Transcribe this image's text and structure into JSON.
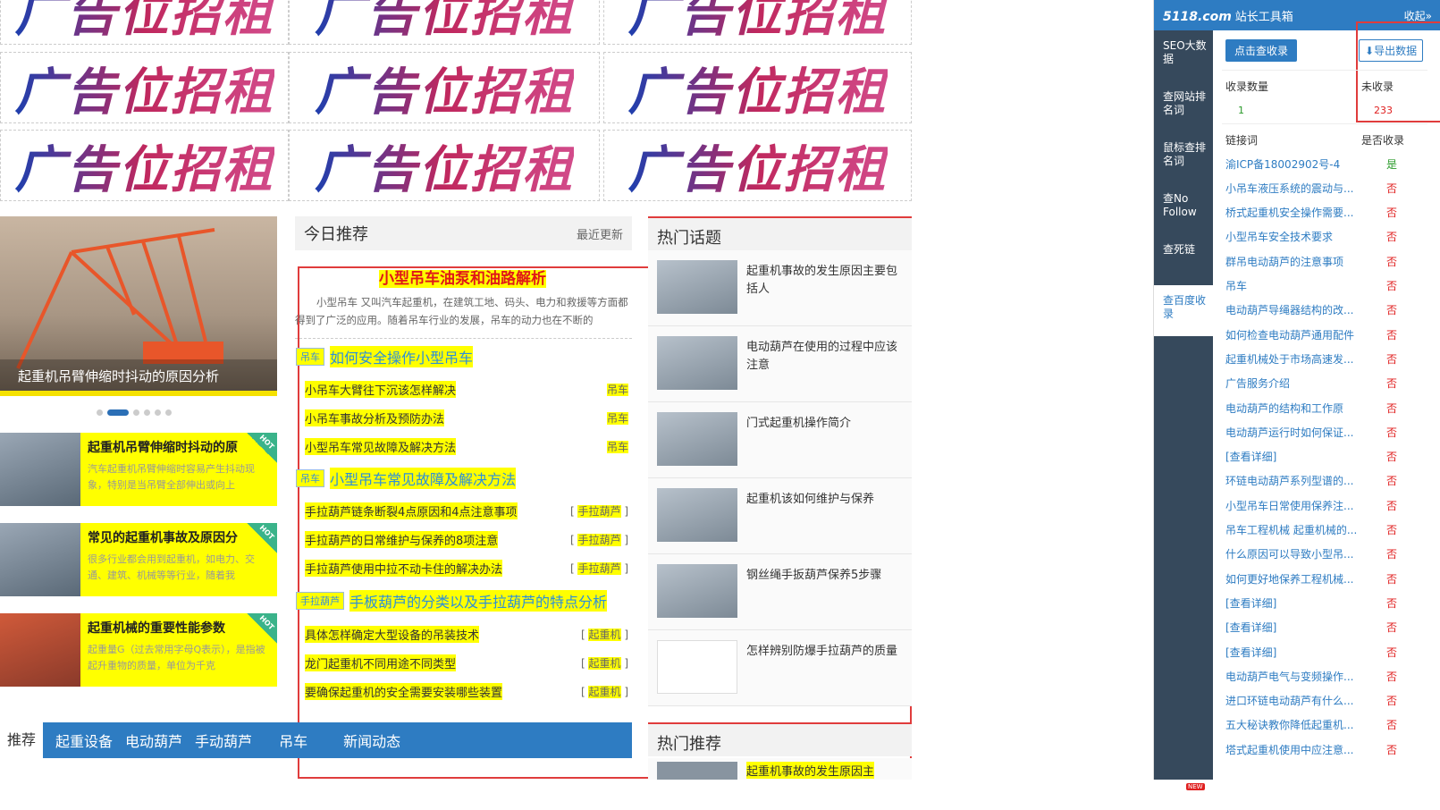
{
  "ads": {
    "label": "广告位招租"
  },
  "slider": {
    "caption": "起重机吊臂伸缩时抖动的原因分析"
  },
  "cards": [
    {
      "title": "起重机吊臂伸缩时抖动的原",
      "desc": "汽车起重机吊臂伸缩时容易产生抖动现象，特别是当吊臂全部伸出或向上",
      "badge": "HOT"
    },
    {
      "title": "常见的起重机事故及原因分",
      "desc": "很多行业都会用到起重机，如电力、交通、建筑、机械等等行业，随着我",
      "badge": "HOT"
    },
    {
      "title": "起重机械的重要性能参数",
      "desc": "起重量G（过去常用字母Q表示），是指被起升重物的质量，单位为千克",
      "badge": "HOT"
    }
  ],
  "recommend": {
    "title": "今日推荐",
    "more": "最近更新",
    "feature_title": "小型吊车油泵和油路解析",
    "feature_desc": "小型吊车 又叫汽车起重机，在建筑工地、码头、电力和救援等方面都得到了广泛的应用。随着吊车行业的发展，吊车的动力也在不断的",
    "sections": [
      {
        "tag": "吊车",
        "title": "如何安全操作小型吊车",
        "rows": [
          {
            "text": "小吊车大臂往下沉该怎样解决",
            "cat": "吊车"
          },
          {
            "text": "小吊车事故分析及预防办法",
            "cat": "吊车"
          },
          {
            "text": "小型吊车常见故障及解决方法",
            "cat": "吊车"
          }
        ]
      },
      {
        "tag": "吊车",
        "title": "小型吊车常见故障及解决方法",
        "rows": [
          {
            "text": "手拉葫芦链条断裂4点原因和4点注意事项",
            "cat": "手拉葫芦"
          },
          {
            "text": "手拉葫芦的日常维护与保养的8项注意",
            "cat": "手拉葫芦"
          },
          {
            "text": "手拉葫芦使用中拉不动卡住的解决办法",
            "cat": "手拉葫芦"
          }
        ]
      },
      {
        "tag": "手拉葫芦",
        "title": "手板葫芦的分类以及手拉葫芦的特点分析",
        "rows": [
          {
            "text": "具体怎样确定大型设备的吊装技术",
            "cat": "起重机"
          },
          {
            "text": "龙门起重机不同用途不同类型",
            "cat": "起重机"
          },
          {
            "text": "要确保起重机的安全需要安装哪些装置",
            "cat": "起重机"
          }
        ]
      }
    ]
  },
  "hot_topics": {
    "title": "热门话题",
    "items": [
      "起重机事故的发生原因主要包括人",
      "电动葫芦在使用的过程中应该注意",
      "门式起重机操作简介",
      "起重机该如何维护与保养",
      "钢丝绳手扳葫芦保养5步骤",
      "怎样辨别防爆手拉葫芦的质量"
    ]
  },
  "hot_recommend": {
    "title": "热门推荐",
    "first": "起重机事故的发生原因主"
  },
  "nav": {
    "items": [
      "推荐",
      "起重设备",
      "电动葫芦",
      "手动葫芦",
      "吊车",
      "新闻动态"
    ]
  },
  "panel": {
    "logo": "5118.com",
    "logo_sub": "站长工具箱",
    "collapse": "收起»",
    "side": [
      "SEO大数据",
      "查网站排名词",
      "鼠标查排名词",
      "查No Follow",
      "查死链",
      "查百度收录"
    ],
    "check_btn": "点击查收录",
    "export_btn": "导出数据",
    "indexed_label": "收录数量",
    "unindexed_label": "未收录",
    "indexed_value": "1",
    "unindexed_value": "233",
    "col_link": "链接词",
    "col_status": "是否收录",
    "rows": [
      {
        "k": "渝ICP备18002902号-4",
        "v": "是"
      },
      {
        "k": "小吊车液压系统的震动与...",
        "v": "否"
      },
      {
        "k": "桥式起重机安全操作需要...",
        "v": "否"
      },
      {
        "k": "小型吊车安全技术要求",
        "v": "否"
      },
      {
        "k": "群吊电动葫芦的注意事项",
        "v": "否"
      },
      {
        "k": "吊车",
        "v": "否"
      },
      {
        "k": "电动葫芦导绳器结构的改...",
        "v": "否"
      },
      {
        "k": "如何检查电动葫芦通用配件",
        "v": "否"
      },
      {
        "k": "起重机械处于市场高速发...",
        "v": "否"
      },
      {
        "k": "广告服务介绍",
        "v": "否"
      },
      {
        "k": "电动葫芦的结构和工作原",
        "v": "否"
      },
      {
        "k": "电动葫芦运行时如何保证...",
        "v": "否"
      },
      {
        "k": "[查看详细]",
        "v": "否"
      },
      {
        "k": "环链电动葫芦系列型谱的...",
        "v": "否"
      },
      {
        "k": "小型吊车日常使用保养注...",
        "v": "否"
      },
      {
        "k": "吊车工程机械 起重机械的...",
        "v": "否"
      },
      {
        "k": "什么原因可以导致小型吊...",
        "v": "否"
      },
      {
        "k": "如何更好地保养工程机械...",
        "v": "否"
      },
      {
        "k": "[查看详细]",
        "v": "否"
      },
      {
        "k": "[查看详细]",
        "v": "否"
      },
      {
        "k": "[查看详细]",
        "v": "否"
      },
      {
        "k": "电动葫芦电气与变频操作...",
        "v": "否"
      },
      {
        "k": "进口环链电动葫芦有什么...",
        "v": "否"
      },
      {
        "k": "五大秘诀教你降低起重机...",
        "v": "否"
      },
      {
        "k": "塔式起重机使用中应注意...",
        "v": "否"
      }
    ],
    "new_badge": "NEW"
  },
  "colors": {
    "accent": "#2e7cc2",
    "highlight": "#ffff00",
    "red": "#e03c3c"
  }
}
